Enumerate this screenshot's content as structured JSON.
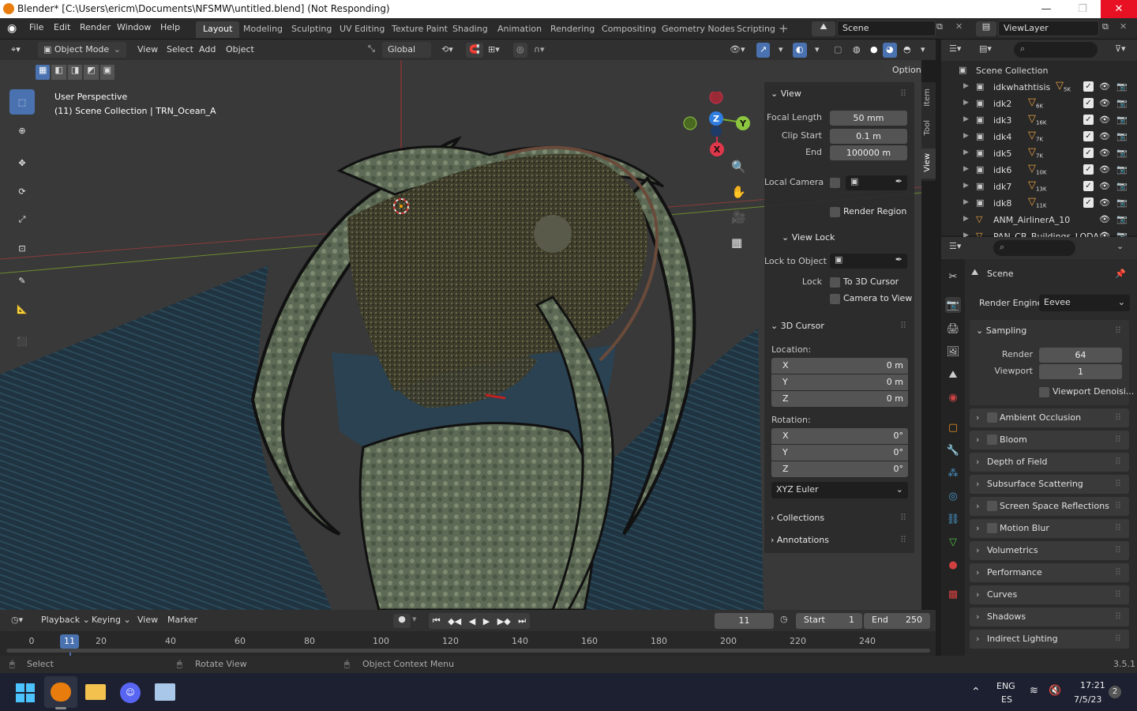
{
  "window": {
    "title": "Blender* [C:\\Users\\ericm\\Documents\\NFSMW\\untitled.blend] (Not Responding)",
    "controls": [
      "—",
      "❐",
      "✕"
    ]
  },
  "menu": [
    "File",
    "Edit",
    "Render",
    "Window",
    "Help"
  ],
  "workspaces": [
    "Layout",
    "Modeling",
    "Sculpting",
    "UV Editing",
    "Texture Paint",
    "Shading",
    "Animation",
    "Rendering",
    "Compositing",
    "Geometry Nodes",
    "Scripting"
  ],
  "add_workspace": "+",
  "scene_name": "Scene",
  "view_layer": "ViewLayer",
  "viewport_header": {
    "mode": "Object Mode",
    "menus": [
      "View",
      "Select",
      "Add",
      "Object"
    ],
    "orientation": "Global",
    "options": "Options"
  },
  "viewport": {
    "perspective": "User Perspective",
    "collection_info": "(11) Scene Collection | TRN_Ocean_A",
    "gizmo_labels": {
      "z": "Z",
      "y": "Y",
      "x": "X"
    }
  },
  "npanel": {
    "tabs": [
      "Item",
      "Tool",
      "View"
    ],
    "view_header": "View",
    "focal_length_label": "Focal Length",
    "focal_length": "50 mm",
    "clip_start_label": "Clip Start",
    "clip_start": "0.1 m",
    "end_label": "End",
    "end": "100000 m",
    "local_camera_label": "Local Camera",
    "render_region": "Render Region",
    "view_lock_header": "View Lock",
    "lock_to_object": "Lock to Object",
    "lock_label": "Lock",
    "to_3d_cursor": "To 3D Cursor",
    "camera_to_view": "Camera to View",
    "cursor_header": "3D Cursor",
    "location_label": "Location:",
    "loc": [
      {
        "axis": "X",
        "value": "0 m"
      },
      {
        "axis": "Y",
        "value": "0 m"
      },
      {
        "axis": "Z",
        "value": "0 m"
      }
    ],
    "rotation_label": "Rotation:",
    "rot": [
      {
        "axis": "X",
        "value": "0°"
      },
      {
        "axis": "Y",
        "value": "0°"
      },
      {
        "axis": "Z",
        "value": "0°"
      }
    ],
    "rotation_mode": "XYZ Euler",
    "collections": "Collections",
    "annotations": "Annotations"
  },
  "outliner": {
    "root": "Scene Collection",
    "items": [
      {
        "name": "idkwhathtisis",
        "badge": "5K"
      },
      {
        "name": "idk2",
        "badge": "6K"
      },
      {
        "name": "idk3",
        "badge": "16K"
      },
      {
        "name": "idk4",
        "badge": "7K"
      },
      {
        "name": "idk5",
        "badge": "7K"
      },
      {
        "name": "idk6",
        "badge": "10K"
      },
      {
        "name": "idk7",
        "badge": "13K"
      },
      {
        "name": "idk8",
        "badge": "11K"
      },
      {
        "name": "ANM_AirlinerA_10",
        "badge": ""
      },
      {
        "name": "PAN_CB_Buildings_LODA",
        "badge": ""
      }
    ]
  },
  "properties": {
    "scene_label": "Scene",
    "render_engine_label": "Render Engine",
    "render_engine": "Eevee",
    "sampling": "Sampling",
    "render_label": "Render",
    "render_samples": "64",
    "viewport_label": "Viewport",
    "viewport_samples": "1",
    "viewport_denoise": "Viewport Denoisi...",
    "sections": [
      {
        "label": "Ambient Occlusion",
        "checkbox": true
      },
      {
        "label": "Bloom",
        "checkbox": true
      },
      {
        "label": "Depth of Field",
        "checkbox": false
      },
      {
        "label": "Subsurface Scattering",
        "checkbox": false
      },
      {
        "label": "Screen Space Reflections",
        "checkbox": true
      },
      {
        "label": "Motion Blur",
        "checkbox": true
      },
      {
        "label": "Volumetrics",
        "checkbox": false
      },
      {
        "label": "Performance",
        "checkbox": false
      },
      {
        "label": "Curves",
        "checkbox": false
      },
      {
        "label": "Shadows",
        "checkbox": false
      },
      {
        "label": "Indirect Lighting",
        "checkbox": false
      }
    ]
  },
  "timeline": {
    "menus": [
      "Playback",
      "Keying",
      "View",
      "Marker"
    ],
    "current_frame": "11",
    "start_label": "Start",
    "start": "1",
    "end_label": "End",
    "end": "250",
    "ticks": [
      "0",
      "20",
      "40",
      "60",
      "80",
      "100",
      "120",
      "140",
      "160",
      "180",
      "200",
      "220",
      "240"
    ],
    "frame_marker": "11"
  },
  "statusbar": {
    "select": "Select",
    "rotate_view": "Rotate View",
    "context_menu": "Object Context Menu",
    "version": "3.5.1"
  },
  "taskbar": {
    "lang_top": "ENG",
    "lang_bottom": "ES",
    "time": "17:21",
    "date": "7/5/23",
    "notifications": "2"
  },
  "colors": {
    "accent": "#4a72b0",
    "gizmo_x": "#e0374b",
    "gizmo_y": "#8cc63f",
    "gizmo_z": "#2f7de0"
  }
}
